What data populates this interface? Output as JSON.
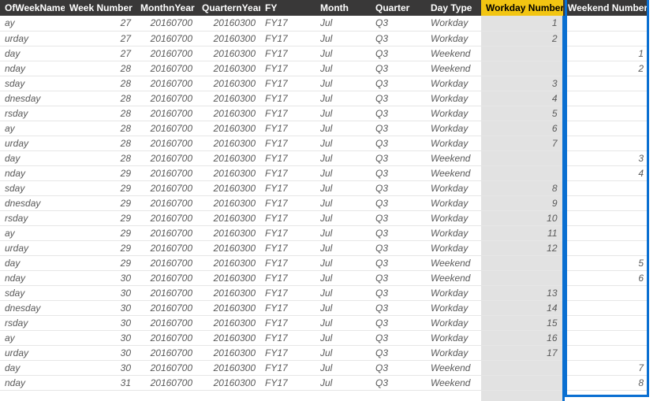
{
  "columns": [
    {
      "key": "dow",
      "label": "OfWeekName",
      "cls": "col-dow",
      "align": "left",
      "selected": false
    },
    {
      "key": "wn",
      "label": "Week Number",
      "cls": "col-wn",
      "align": "right",
      "selected": false
    },
    {
      "key": "my",
      "label": "MonthnYear",
      "cls": "col-my",
      "align": "right",
      "selected": false
    },
    {
      "key": "qy",
      "label": "QuarternYear",
      "cls": "col-qy",
      "align": "right",
      "selected": false
    },
    {
      "key": "fy",
      "label": "FY",
      "cls": "col-fy",
      "align": "left",
      "selected": false
    },
    {
      "key": "mo",
      "label": "Month",
      "cls": "col-mo",
      "align": "left",
      "selected": false
    },
    {
      "key": "qt",
      "label": "Quarter",
      "cls": "col-qt",
      "align": "left",
      "selected": false
    },
    {
      "key": "dt",
      "label": "Day Type",
      "cls": "col-dt",
      "align": "left",
      "selected": false
    },
    {
      "key": "wd",
      "label": "Workday Number",
      "cls": "col-wd",
      "align": "right",
      "selected": true
    },
    {
      "key": "we",
      "label": "Weekend Number",
      "cls": "col-we",
      "align": "right",
      "selected": false
    }
  ],
  "rows": [
    {
      "dow": "ay",
      "wn": "27",
      "my": "20160700",
      "qy": "20160300",
      "fy": "FY17",
      "mo": "Jul",
      "qt": "Q3",
      "dt": "Workday",
      "wd": "1",
      "we": ""
    },
    {
      "dow": "urday",
      "wn": "27",
      "my": "20160700",
      "qy": "20160300",
      "fy": "FY17",
      "mo": "Jul",
      "qt": "Q3",
      "dt": "Workday",
      "wd": "2",
      "we": ""
    },
    {
      "dow": "day",
      "wn": "27",
      "my": "20160700",
      "qy": "20160300",
      "fy": "FY17",
      "mo": "Jul",
      "qt": "Q3",
      "dt": "Weekend",
      "wd": "",
      "we": "1"
    },
    {
      "dow": "nday",
      "wn": "28",
      "my": "20160700",
      "qy": "20160300",
      "fy": "FY17",
      "mo": "Jul",
      "qt": "Q3",
      "dt": "Weekend",
      "wd": "",
      "we": "2"
    },
    {
      "dow": "sday",
      "wn": "28",
      "my": "20160700",
      "qy": "20160300",
      "fy": "FY17",
      "mo": "Jul",
      "qt": "Q3",
      "dt": "Workday",
      "wd": "3",
      "we": ""
    },
    {
      "dow": "dnesday",
      "wn": "28",
      "my": "20160700",
      "qy": "20160300",
      "fy": "FY17",
      "mo": "Jul",
      "qt": "Q3",
      "dt": "Workday",
      "wd": "4",
      "we": ""
    },
    {
      "dow": "rsday",
      "wn": "28",
      "my": "20160700",
      "qy": "20160300",
      "fy": "FY17",
      "mo": "Jul",
      "qt": "Q3",
      "dt": "Workday",
      "wd": "5",
      "we": ""
    },
    {
      "dow": "ay",
      "wn": "28",
      "my": "20160700",
      "qy": "20160300",
      "fy": "FY17",
      "mo": "Jul",
      "qt": "Q3",
      "dt": "Workday",
      "wd": "6",
      "we": ""
    },
    {
      "dow": "urday",
      "wn": "28",
      "my": "20160700",
      "qy": "20160300",
      "fy": "FY17",
      "mo": "Jul",
      "qt": "Q3",
      "dt": "Workday",
      "wd": "7",
      "we": ""
    },
    {
      "dow": "day",
      "wn": "28",
      "my": "20160700",
      "qy": "20160300",
      "fy": "FY17",
      "mo": "Jul",
      "qt": "Q3",
      "dt": "Weekend",
      "wd": "",
      "we": "3"
    },
    {
      "dow": "nday",
      "wn": "29",
      "my": "20160700",
      "qy": "20160300",
      "fy": "FY17",
      "mo": "Jul",
      "qt": "Q3",
      "dt": "Weekend",
      "wd": "",
      "we": "4"
    },
    {
      "dow": "sday",
      "wn": "29",
      "my": "20160700",
      "qy": "20160300",
      "fy": "FY17",
      "mo": "Jul",
      "qt": "Q3",
      "dt": "Workday",
      "wd": "8",
      "we": ""
    },
    {
      "dow": "dnesday",
      "wn": "29",
      "my": "20160700",
      "qy": "20160300",
      "fy": "FY17",
      "mo": "Jul",
      "qt": "Q3",
      "dt": "Workday",
      "wd": "9",
      "we": ""
    },
    {
      "dow": "rsday",
      "wn": "29",
      "my": "20160700",
      "qy": "20160300",
      "fy": "FY17",
      "mo": "Jul",
      "qt": "Q3",
      "dt": "Workday",
      "wd": "10",
      "we": ""
    },
    {
      "dow": "ay",
      "wn": "29",
      "my": "20160700",
      "qy": "20160300",
      "fy": "FY17",
      "mo": "Jul",
      "qt": "Q3",
      "dt": "Workday",
      "wd": "11",
      "we": ""
    },
    {
      "dow": "urday",
      "wn": "29",
      "my": "20160700",
      "qy": "20160300",
      "fy": "FY17",
      "mo": "Jul",
      "qt": "Q3",
      "dt": "Workday",
      "wd": "12",
      "we": ""
    },
    {
      "dow": "day",
      "wn": "29",
      "my": "20160700",
      "qy": "20160300",
      "fy": "FY17",
      "mo": "Jul",
      "qt": "Q3",
      "dt": "Weekend",
      "wd": "",
      "we": "5"
    },
    {
      "dow": "nday",
      "wn": "30",
      "my": "20160700",
      "qy": "20160300",
      "fy": "FY17",
      "mo": "Jul",
      "qt": "Q3",
      "dt": "Weekend",
      "wd": "",
      "we": "6"
    },
    {
      "dow": "sday",
      "wn": "30",
      "my": "20160700",
      "qy": "20160300",
      "fy": "FY17",
      "mo": "Jul",
      "qt": "Q3",
      "dt": "Workday",
      "wd": "13",
      "we": ""
    },
    {
      "dow": "dnesday",
      "wn": "30",
      "my": "20160700",
      "qy": "20160300",
      "fy": "FY17",
      "mo": "Jul",
      "qt": "Q3",
      "dt": "Workday",
      "wd": "14",
      "we": ""
    },
    {
      "dow": "rsday",
      "wn": "30",
      "my": "20160700",
      "qy": "20160300",
      "fy": "FY17",
      "mo": "Jul",
      "qt": "Q3",
      "dt": "Workday",
      "wd": "15",
      "we": ""
    },
    {
      "dow": "ay",
      "wn": "30",
      "my": "20160700",
      "qy": "20160300",
      "fy": "FY17",
      "mo": "Jul",
      "qt": "Q3",
      "dt": "Workday",
      "wd": "16",
      "we": ""
    },
    {
      "dow": "urday",
      "wn": "30",
      "my": "20160700",
      "qy": "20160300",
      "fy": "FY17",
      "mo": "Jul",
      "qt": "Q3",
      "dt": "Workday",
      "wd": "17",
      "we": ""
    },
    {
      "dow": "day",
      "wn": "30",
      "my": "20160700",
      "qy": "20160300",
      "fy": "FY17",
      "mo": "Jul",
      "qt": "Q3",
      "dt": "Weekend",
      "wd": "",
      "we": "7"
    },
    {
      "dow": "nday",
      "wn": "31",
      "my": "20160700",
      "qy": "20160300",
      "fy": "FY17",
      "mo": "Jul",
      "qt": "Q3",
      "dt": "Weekend",
      "wd": "",
      "we": "8"
    },
    {
      "dow": "",
      "wn": "",
      "my": "",
      "qy": "",
      "fy": "",
      "mo": "",
      "qt": "",
      "dt": "",
      "wd": "",
      "we": ""
    }
  ]
}
